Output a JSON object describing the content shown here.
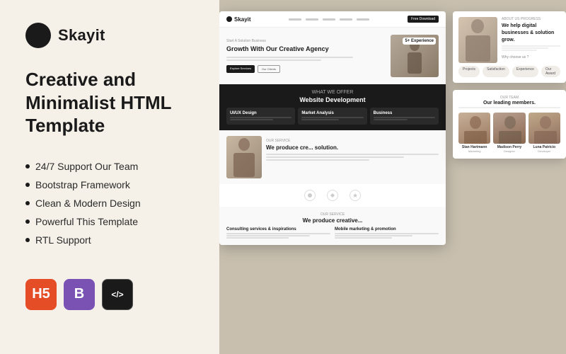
{
  "logo": {
    "text": "Skayit"
  },
  "product": {
    "title": "Creative and Minimalist HTML Template",
    "features": [
      "24/7 Support Our Team",
      "Bootstrap Framework",
      "Clean & Modern Design",
      "Powerful This Template",
      "RTL Support"
    ]
  },
  "badges": [
    {
      "name": "HTML5",
      "label": "H5",
      "type": "html"
    },
    {
      "name": "Bootstrap",
      "label": "B",
      "type": "bootstrap"
    },
    {
      "name": "Code",
      "label": "</>",
      "type": "code"
    }
  ],
  "preview": {
    "nav": {
      "logo": "Skayit",
      "cta": "Free Download"
    },
    "hero": {
      "tag": "Start A Solution Business",
      "title": "Growth With Our Creative Agency",
      "badge": "5+ Experience"
    },
    "dark_section": {
      "label": "WHAT WE OFFER",
      "heading": "Website Development",
      "cards": [
        "UI/UX Design",
        "Market Analysis",
        "Business"
      ]
    },
    "about": {
      "label": "ABOUT US PROGRESS",
      "heading": "We help digital businesses & solution grow.",
      "stats": [
        "Projects",
        "Satisfaction",
        "Experience",
        "Our Award"
      ]
    },
    "team": {
      "label": "OUR TEAM",
      "heading": "Our leading members.",
      "members": [
        {
          "name": "Stan Hartmann",
          "role": "Marketing"
        },
        {
          "name": "Madison Perry",
          "role": "Designer"
        },
        {
          "name": "Luna Patricio",
          "role": "Developer"
        }
      ]
    }
  }
}
